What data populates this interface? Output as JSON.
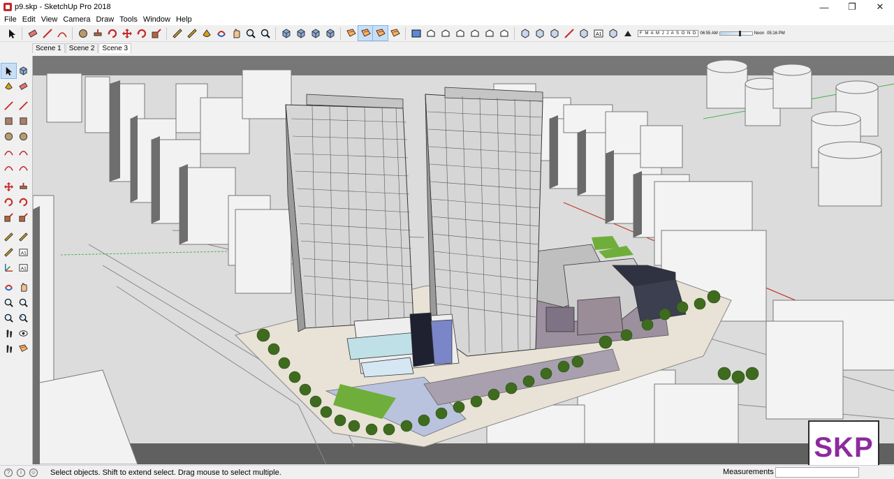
{
  "window": {
    "title": "p9.skp - SketchUp Pro 2018",
    "min": "—",
    "max": "❐",
    "close": "✕"
  },
  "menu": [
    "File",
    "Edit",
    "View",
    "Camera",
    "Draw",
    "Tools",
    "Window",
    "Help"
  ],
  "toolbar": {
    "icons": [
      "select-icon",
      "eraser-icon",
      "line-icon",
      "arc-icon",
      "circle-icon",
      "pushpull-icon",
      "followme-icon",
      "move-icon",
      "rotate-icon",
      "scale-icon",
      "tape-icon",
      "dimension-icon",
      "paint-icon",
      "orbit-icon",
      "pan-icon",
      "zoom-icon",
      "zoom-extents-icon",
      "warehouse-icon",
      "extension-icon",
      "component-icon",
      "solid-icon",
      "section-plane-icon",
      "section-display-icon",
      "section-cut-icon",
      "section-fill-icon",
      "model-info-icon",
      "iso-view-icon",
      "top-view-icon",
      "front-view-icon",
      "right-view-icon",
      "back-view-icon",
      "left-view-icon",
      "xray-icon",
      "backedges-icon",
      "wireframe-icon",
      "hiddenline-icon",
      "shaded-icon",
      "textured-icon",
      "monochrome-icon",
      "shadows-toggle-icon"
    ],
    "active_icons": [
      "section-display-icon",
      "section-cut-icon"
    ],
    "shadow_months": "F M A M J J A S O N D",
    "shadow_time_start": "06:55 AM",
    "shadow_noon": "Noon",
    "shadow_time_end": "05:16 PM"
  },
  "scenes": [
    "Scene 1",
    "Scene 2",
    "Scene 3"
  ],
  "active_scene": "Scene 3",
  "left_tools": [
    [
      "select-icon",
      "component-icon"
    ],
    [
      "paint-icon",
      "eraser-icon"
    ],
    [
      "line-icon",
      "freehand-icon"
    ],
    [
      "rectangle-icon",
      "rotated-rect-icon"
    ],
    [
      "circle-icon",
      "polygon-icon"
    ],
    [
      "arc-icon",
      "arc-2pt-icon"
    ],
    [
      "arc-3pt-icon",
      "pie-icon"
    ],
    [
      "move-icon",
      "pushpull-icon"
    ],
    [
      "rotate-icon",
      "followme-icon"
    ],
    [
      "scale-icon",
      "offset-icon"
    ],
    [
      "tape-icon",
      "dimension-icon"
    ],
    [
      "protractor-icon",
      "text-icon"
    ],
    [
      "axes-icon",
      "3dtext-icon"
    ],
    [
      "orbit-icon",
      "pan-icon"
    ],
    [
      "zoom-icon",
      "zoom-window-icon"
    ],
    [
      "zoom-extents-icon",
      "previous-view-icon"
    ],
    [
      "position-camera-icon",
      "lookaround-icon"
    ],
    [
      "walk-icon",
      "section-plane-icon"
    ]
  ],
  "status": {
    "message": "Select objects. Shift to extend select. Drag mouse to select multiple.",
    "measurements_label": "Measurements",
    "measurements_value": ""
  },
  "logo": "SKP",
  "colors": {
    "accent": "#7eb4ea",
    "logo": "#8d2a9e",
    "sky": "#e6e6e6",
    "ground": "#d9d9d9"
  }
}
